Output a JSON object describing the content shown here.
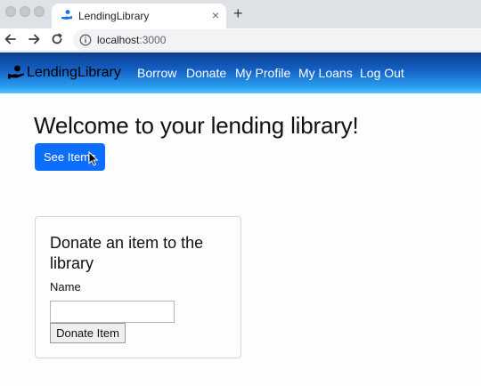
{
  "browser": {
    "tab_title": "LendingLibrary",
    "tab_close": "×",
    "new_tab": "+",
    "url_host": "localhost",
    "url_port": ":3000"
  },
  "navbar": {
    "brand": "LendingLibrary",
    "links": [
      "Borrow",
      "Donate",
      "My Profile",
      "My Loans",
      "Log Out"
    ]
  },
  "main": {
    "title": "Welcome to your lending library!",
    "see_items_button": "See Items"
  },
  "donate_card": {
    "title": "Donate an item to the library",
    "name_label": "Name",
    "name_value": "",
    "submit_label": "Donate Item"
  },
  "colors": {
    "primary": "#0d6efd",
    "navbar_top": "#0a3e8f",
    "navbar_bottom": "#55c5fb"
  }
}
